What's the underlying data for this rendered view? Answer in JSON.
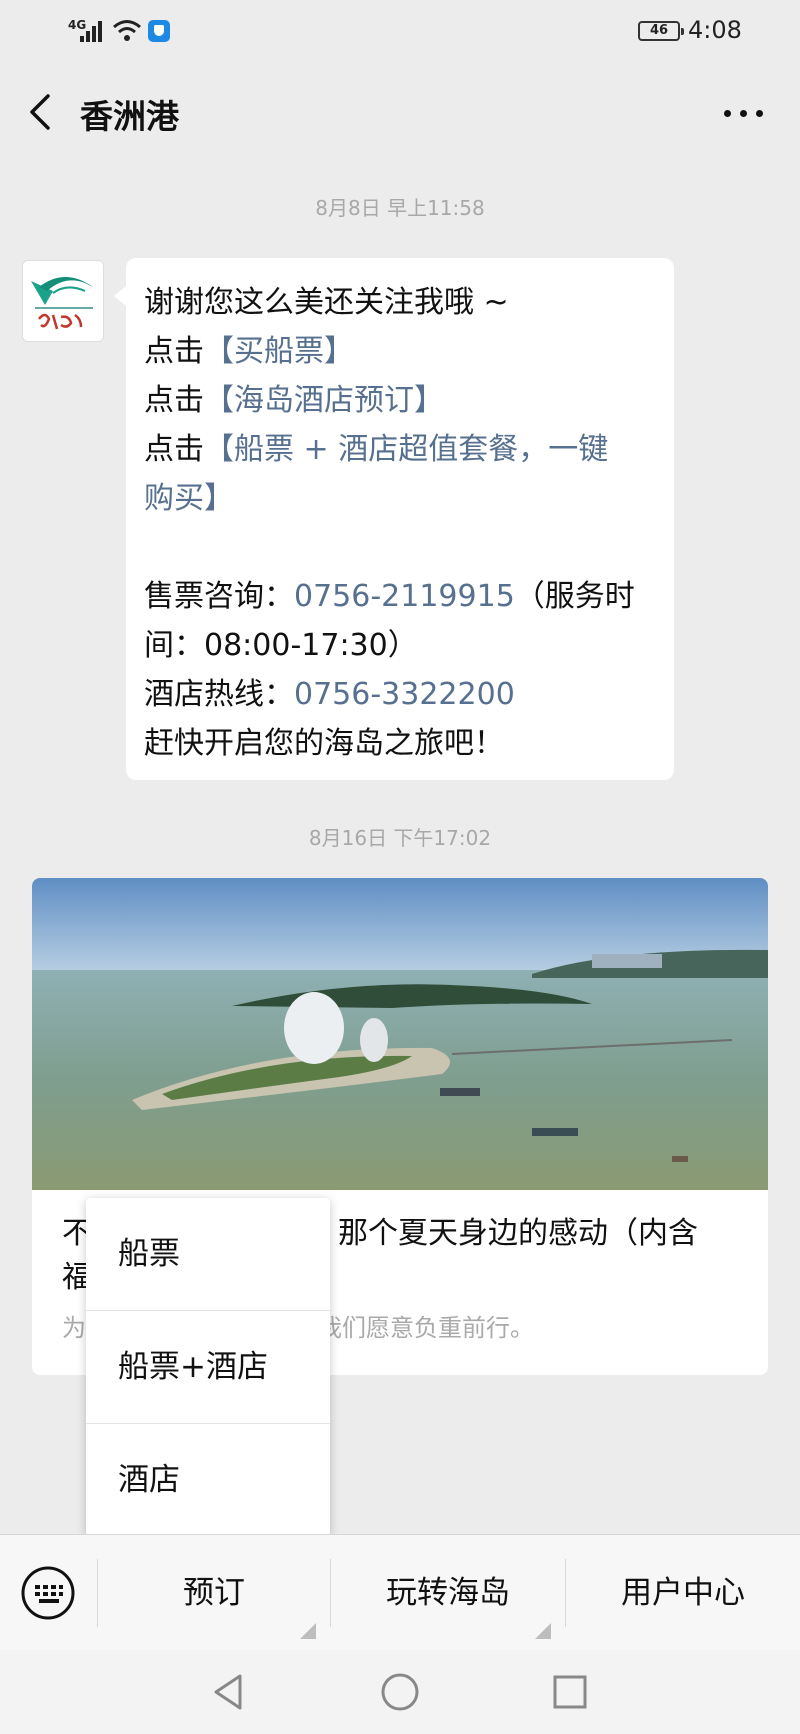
{
  "status_bar": {
    "network": "4G",
    "battery": "46",
    "time": "4:08"
  },
  "header": {
    "title": "香洲港",
    "back_icon": "chevron-left-icon",
    "more_icon": "more-horizontal-icon"
  },
  "messages": [
    {
      "timestamp": "8月8日 早上11:58",
      "lines": [
        {
          "prefix": "谢谢您这么美还关注我哦 ~",
          "link": "",
          "suffix": ""
        },
        {
          "prefix": "点击",
          "link": "【买船票】",
          "suffix": ""
        },
        {
          "prefix": "点击",
          "link": "【海岛酒店预订】",
          "suffix": ""
        },
        {
          "prefix": "点击",
          "link": "【船票 + 酒店超值套餐，一键",
          "suffix": ""
        },
        {
          "prefix": "",
          "link": "购买】",
          "suffix": ""
        },
        {
          "prefix": "售票咨询：",
          "link": "0756-2119915",
          "suffix": "（服务时"
        },
        {
          "prefix": "间：08:00-17:30）",
          "link": "",
          "suffix": ""
        },
        {
          "prefix": "酒店热线：",
          "link": "0756-3322200",
          "suffix": ""
        },
        {
          "prefix": "赶快开启您的海岛之旅吧！",
          "link": "",
          "suffix": ""
        }
      ]
    },
    {
      "timestamp": "8月16日 下午17:02",
      "article": {
        "title_line1_start": "不",
        "title_line1_end": "那个夏天身边的感动（内含",
        "title_line2_start": "福",
        "desc_start": "为",
        "desc_end": "我们愿意负重前行。"
      }
    }
  ],
  "popup_menu": {
    "items": [
      "船票",
      "船票+酒店",
      "酒店"
    ]
  },
  "bottom_menu": {
    "keyboard_icon": "keyboard-icon",
    "items": [
      "预订",
      "玩转海岛",
      "用户中心"
    ]
  },
  "nav_bar": {
    "icons": [
      "back-triangle-icon",
      "home-circle-icon",
      "recents-square-icon"
    ]
  },
  "colors": {
    "link": "#57708f",
    "background": "#ececec",
    "timestamp": "#a8a8a8"
  }
}
